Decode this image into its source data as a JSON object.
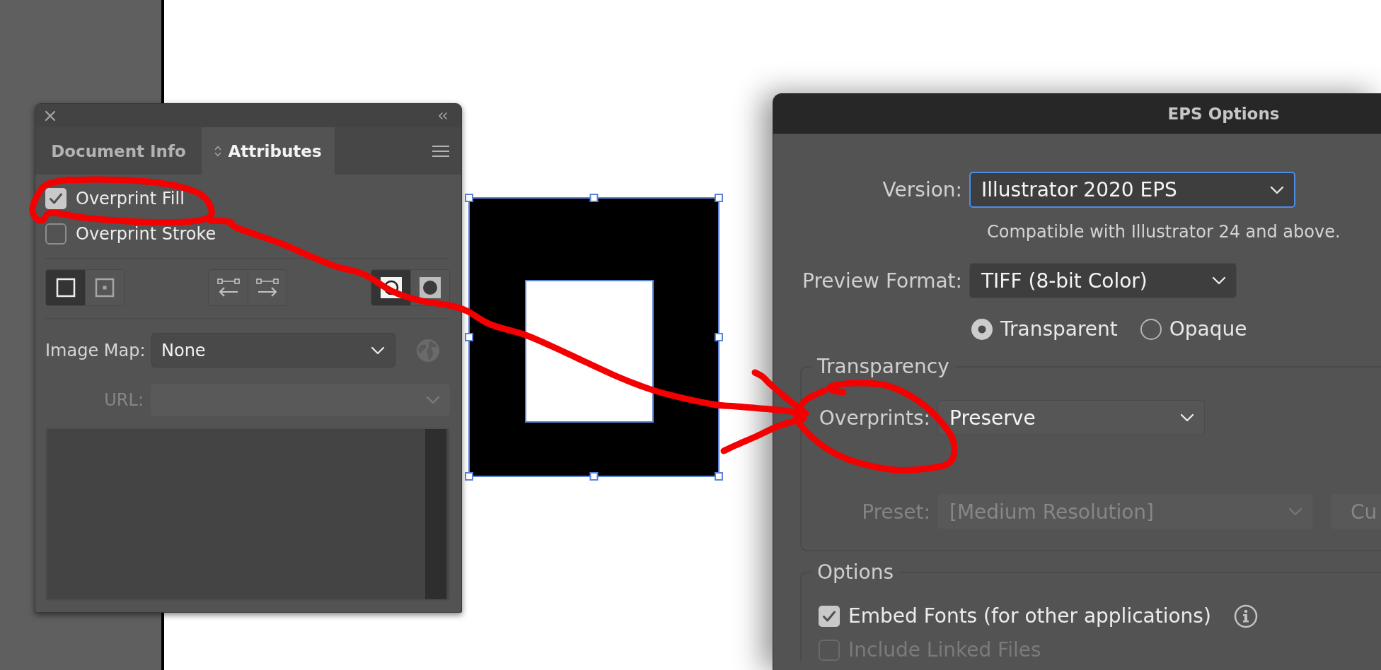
{
  "attributes_panel": {
    "tabs": [
      {
        "label": "Document Info",
        "selected": false
      },
      {
        "label": "Attributes",
        "selected": true
      }
    ],
    "overprint_options": [
      {
        "label": "Overprint Fill",
        "checked": true
      },
      {
        "label": "Overprint Stroke",
        "checked": false
      }
    ],
    "button_groups": [
      {
        "buttons": [
          {
            "kind": "hidecenter",
            "selected": true
          },
          {
            "kind": "showcenter",
            "selected": false
          }
        ]
      },
      {
        "buttons": [
          {
            "kind": "reverseoff",
            "selected": false
          },
          {
            "kind": "reverseon",
            "selected": false
          }
        ]
      },
      {
        "buttons": [
          {
            "kind": "nonzero",
            "selected": true
          },
          {
            "kind": "evenodd",
            "selected": false
          }
        ]
      }
    ],
    "image_map": {
      "label": "Image Map:",
      "value": "None"
    },
    "browser_button": {
      "disabled": true
    },
    "url": {
      "label": "URL:",
      "disabled": true
    }
  },
  "canvas": {
    "selected": true
  },
  "eps_dialog": {
    "title": "EPS Options",
    "version": {
      "label": "Version:",
      "value": "Illustrator 2020 EPS",
      "focused": true
    },
    "compatibility_note": "Compatible with Illustrator 24 and above.",
    "preview_format": {
      "label": "Preview Format:",
      "value": "TIFF (8-bit Color)",
      "focused": false
    },
    "preview_background": [
      {
        "label": "Transparent",
        "selected": true
      },
      {
        "label": "Opaque",
        "selected": false
      }
    ],
    "transparency": {
      "legend": "Transparency",
      "overprints": {
        "label": "Overprints:",
        "value": "Preserve",
        "disabled": false
      },
      "preset": {
        "label": "Preset:",
        "value": "[Medium Resolution]",
        "disabled": true
      },
      "preset_button": {
        "label": "Cu",
        "disabled": true
      }
    },
    "options": {
      "legend": "Options",
      "items": [
        {
          "label": "Embed Fonts (for other applications)",
          "checked": true,
          "disabled": false,
          "info": true
        },
        {
          "label": "Include Linked Files",
          "checked": false,
          "disabled": true
        }
      ]
    }
  }
}
